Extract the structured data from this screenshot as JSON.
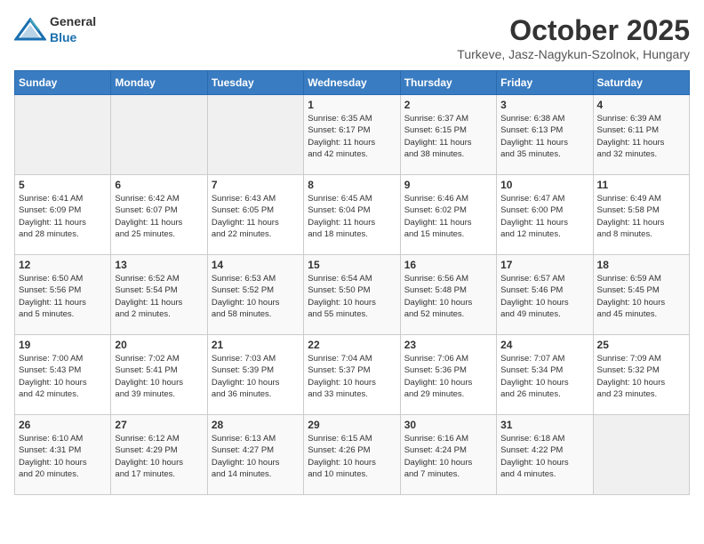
{
  "header": {
    "logo_general": "General",
    "logo_blue": "Blue",
    "title": "October 2025",
    "subtitle": "Turkeve, Jasz-Nagykun-Szolnok, Hungary"
  },
  "weekdays": [
    "Sunday",
    "Monday",
    "Tuesday",
    "Wednesday",
    "Thursday",
    "Friday",
    "Saturday"
  ],
  "weeks": [
    [
      {
        "day": "",
        "info": ""
      },
      {
        "day": "",
        "info": ""
      },
      {
        "day": "",
        "info": ""
      },
      {
        "day": "1",
        "info": "Sunrise: 6:35 AM\nSunset: 6:17 PM\nDaylight: 11 hours\nand 42 minutes."
      },
      {
        "day": "2",
        "info": "Sunrise: 6:37 AM\nSunset: 6:15 PM\nDaylight: 11 hours\nand 38 minutes."
      },
      {
        "day": "3",
        "info": "Sunrise: 6:38 AM\nSunset: 6:13 PM\nDaylight: 11 hours\nand 35 minutes."
      },
      {
        "day": "4",
        "info": "Sunrise: 6:39 AM\nSunset: 6:11 PM\nDaylight: 11 hours\nand 32 minutes."
      }
    ],
    [
      {
        "day": "5",
        "info": "Sunrise: 6:41 AM\nSunset: 6:09 PM\nDaylight: 11 hours\nand 28 minutes."
      },
      {
        "day": "6",
        "info": "Sunrise: 6:42 AM\nSunset: 6:07 PM\nDaylight: 11 hours\nand 25 minutes."
      },
      {
        "day": "7",
        "info": "Sunrise: 6:43 AM\nSunset: 6:05 PM\nDaylight: 11 hours\nand 22 minutes."
      },
      {
        "day": "8",
        "info": "Sunrise: 6:45 AM\nSunset: 6:04 PM\nDaylight: 11 hours\nand 18 minutes."
      },
      {
        "day": "9",
        "info": "Sunrise: 6:46 AM\nSunset: 6:02 PM\nDaylight: 11 hours\nand 15 minutes."
      },
      {
        "day": "10",
        "info": "Sunrise: 6:47 AM\nSunset: 6:00 PM\nDaylight: 11 hours\nand 12 minutes."
      },
      {
        "day": "11",
        "info": "Sunrise: 6:49 AM\nSunset: 5:58 PM\nDaylight: 11 hours\nand 8 minutes."
      }
    ],
    [
      {
        "day": "12",
        "info": "Sunrise: 6:50 AM\nSunset: 5:56 PM\nDaylight: 11 hours\nand 5 minutes."
      },
      {
        "day": "13",
        "info": "Sunrise: 6:52 AM\nSunset: 5:54 PM\nDaylight: 11 hours\nand 2 minutes."
      },
      {
        "day": "14",
        "info": "Sunrise: 6:53 AM\nSunset: 5:52 PM\nDaylight: 10 hours\nand 58 minutes."
      },
      {
        "day": "15",
        "info": "Sunrise: 6:54 AM\nSunset: 5:50 PM\nDaylight: 10 hours\nand 55 minutes."
      },
      {
        "day": "16",
        "info": "Sunrise: 6:56 AM\nSunset: 5:48 PM\nDaylight: 10 hours\nand 52 minutes."
      },
      {
        "day": "17",
        "info": "Sunrise: 6:57 AM\nSunset: 5:46 PM\nDaylight: 10 hours\nand 49 minutes."
      },
      {
        "day": "18",
        "info": "Sunrise: 6:59 AM\nSunset: 5:45 PM\nDaylight: 10 hours\nand 45 minutes."
      }
    ],
    [
      {
        "day": "19",
        "info": "Sunrise: 7:00 AM\nSunset: 5:43 PM\nDaylight: 10 hours\nand 42 minutes."
      },
      {
        "day": "20",
        "info": "Sunrise: 7:02 AM\nSunset: 5:41 PM\nDaylight: 10 hours\nand 39 minutes."
      },
      {
        "day": "21",
        "info": "Sunrise: 7:03 AM\nSunset: 5:39 PM\nDaylight: 10 hours\nand 36 minutes."
      },
      {
        "day": "22",
        "info": "Sunrise: 7:04 AM\nSunset: 5:37 PM\nDaylight: 10 hours\nand 33 minutes."
      },
      {
        "day": "23",
        "info": "Sunrise: 7:06 AM\nSunset: 5:36 PM\nDaylight: 10 hours\nand 29 minutes."
      },
      {
        "day": "24",
        "info": "Sunrise: 7:07 AM\nSunset: 5:34 PM\nDaylight: 10 hours\nand 26 minutes."
      },
      {
        "day": "25",
        "info": "Sunrise: 7:09 AM\nSunset: 5:32 PM\nDaylight: 10 hours\nand 23 minutes."
      }
    ],
    [
      {
        "day": "26",
        "info": "Sunrise: 6:10 AM\nSunset: 4:31 PM\nDaylight: 10 hours\nand 20 minutes."
      },
      {
        "day": "27",
        "info": "Sunrise: 6:12 AM\nSunset: 4:29 PM\nDaylight: 10 hours\nand 17 minutes."
      },
      {
        "day": "28",
        "info": "Sunrise: 6:13 AM\nSunset: 4:27 PM\nDaylight: 10 hours\nand 14 minutes."
      },
      {
        "day": "29",
        "info": "Sunrise: 6:15 AM\nSunset: 4:26 PM\nDaylight: 10 hours\nand 10 minutes."
      },
      {
        "day": "30",
        "info": "Sunrise: 6:16 AM\nSunset: 4:24 PM\nDaylight: 10 hours\nand 7 minutes."
      },
      {
        "day": "31",
        "info": "Sunrise: 6:18 AM\nSunset: 4:22 PM\nDaylight: 10 hours\nand 4 minutes."
      },
      {
        "day": "",
        "info": ""
      }
    ]
  ]
}
